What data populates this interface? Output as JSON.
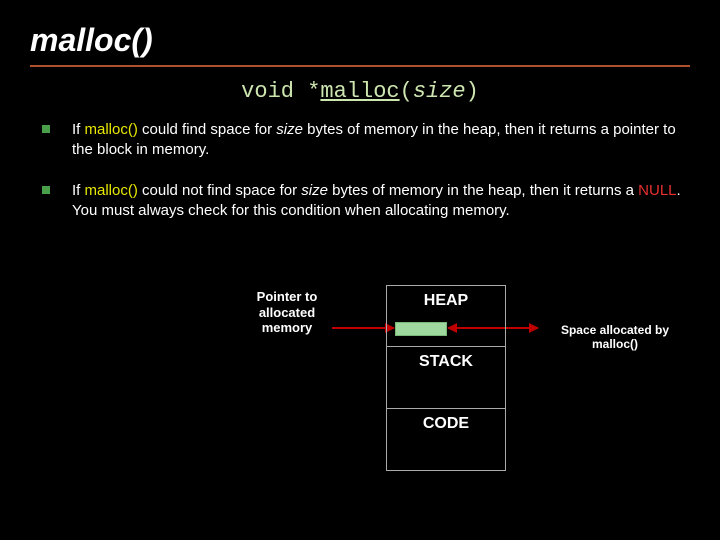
{
  "title": "malloc()",
  "signature": {
    "ret": "void",
    "star": "*",
    "fn": "malloc",
    "open": "(",
    "arg": "size",
    "close": ")"
  },
  "bullet1": {
    "pre": "If ",
    "fn": "malloc()",
    "mid1": " could find space for ",
    "size": "size",
    "post": " bytes of memory in the heap, then it returns a pointer to the block in memory."
  },
  "bullet2": {
    "pre": " If ",
    "fn": "malloc()",
    "mid1": " could not find space for ",
    "size": "size",
    "mid2": " bytes of memory in the heap, then it returns a ",
    "null": "NULL",
    "post": ". You must always check for this condition when allocating memory."
  },
  "diagram": {
    "ptr_label_l1": "Pointer to",
    "ptr_label_l2": "allocated",
    "ptr_label_l3": "memory",
    "heap": "HEAP",
    "stack": "STACK",
    "code": "CODE",
    "space_l1": "Space allocated by",
    "space_l2": "malloc()"
  }
}
